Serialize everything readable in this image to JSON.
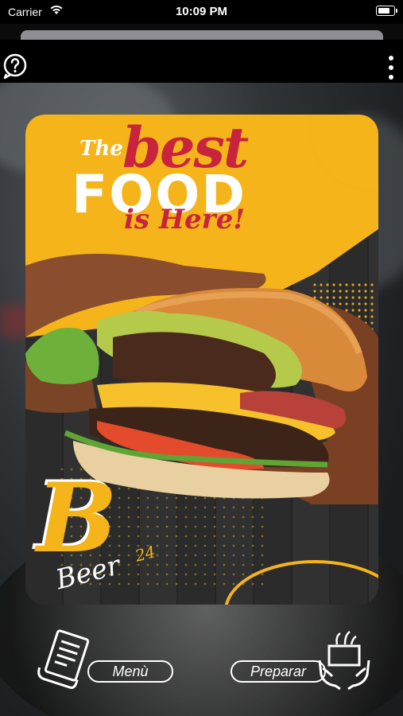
{
  "status_bar": {
    "carrier": "Carrier",
    "time": "10:09 PM",
    "battery_level": 0.85
  },
  "top_bar": {
    "help_icon": "question-bubble-icon",
    "more_icon": "vertical-ellipsis-icon"
  },
  "poster": {
    "headline_the": "The",
    "headline_best": "best",
    "headline_food": "FOOD",
    "headline_is_here": "is Here!",
    "logo_letter": "B",
    "logo_word": "Beer",
    "logo_number": "24",
    "colors": {
      "yellow": "#f4b41a",
      "red": "#c8243d"
    }
  },
  "bottom_actions": {
    "menu_label": "Menù",
    "menu_icon": "menu-document-icon",
    "prepare_label": "Preparar",
    "prepare_icon": "hands-serving-icon"
  }
}
